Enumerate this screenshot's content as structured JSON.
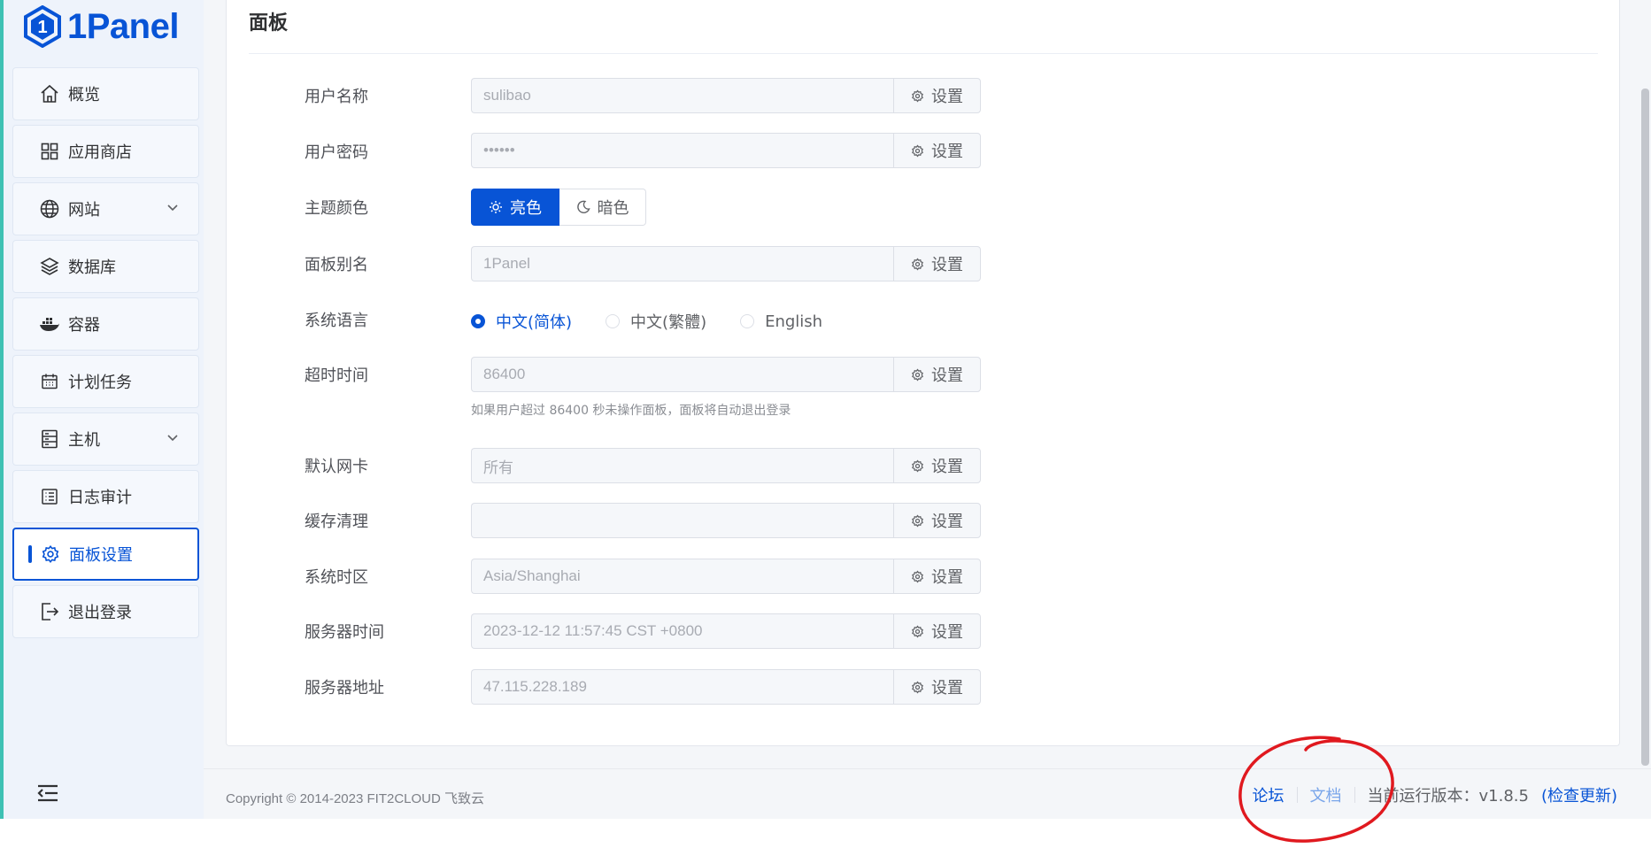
{
  "brand": {
    "name": "1Panel",
    "color": "#0854d6"
  },
  "sidebar": {
    "items": [
      {
        "label": "概览",
        "icon": "home-icon"
      },
      {
        "label": "应用商店",
        "icon": "grid-icon"
      },
      {
        "label": "网站",
        "icon": "globe-icon",
        "expandable": true
      },
      {
        "label": "数据库",
        "icon": "layers-icon"
      },
      {
        "label": "容器",
        "icon": "docker-icon"
      },
      {
        "label": "计划任务",
        "icon": "calendar-icon"
      },
      {
        "label": "主机",
        "icon": "server-icon",
        "expandable": true
      },
      {
        "label": "日志审计",
        "icon": "log-icon"
      },
      {
        "label": "面板设置",
        "icon": "gear-icon",
        "active": true
      },
      {
        "label": "退出登录",
        "icon": "logout-icon"
      }
    ],
    "collapse_icon": "menu-fold-icon"
  },
  "panel": {
    "title": "面板",
    "set_label": "设置",
    "fields": {
      "username": {
        "label": "用户名称",
        "value": "sulibao"
      },
      "password": {
        "label": "用户密码",
        "value": "••••••"
      },
      "theme": {
        "label": "主题颜色",
        "light": "亮色",
        "dark": "暗色",
        "selected": "亮色"
      },
      "alias": {
        "label": "面板别名",
        "value": "1Panel"
      },
      "language": {
        "label": "系统语言",
        "options": [
          "中文(简体)",
          "中文(繁體)",
          "English"
        ],
        "selected": "中文(简体)"
      },
      "timeout": {
        "label": "超时时间",
        "value": "86400",
        "helper": "如果用户超过 86400 秒未操作面板，面板将自动退出登录"
      },
      "nic": {
        "label": "默认网卡",
        "value": "所有"
      },
      "cache": {
        "label": "缓存清理",
        "value": ""
      },
      "timezone": {
        "label": "系统时区",
        "value": "Asia/Shanghai"
      },
      "server_time": {
        "label": "服务器时间",
        "value": "2023-12-12 11:57:45 CST +0800"
      },
      "server_addr": {
        "label": "服务器地址",
        "value": "47.115.228.189"
      }
    }
  },
  "footer": {
    "copyright": "Copyright © 2014-2023 FIT2CLOUD 飞致云",
    "forum": "论坛",
    "docs": "文档",
    "version": "当前运行版本：v1.8.5",
    "check_update": "(检查更新)"
  },
  "annotation": {
    "type": "red-circle",
    "color": "#e0191f"
  }
}
